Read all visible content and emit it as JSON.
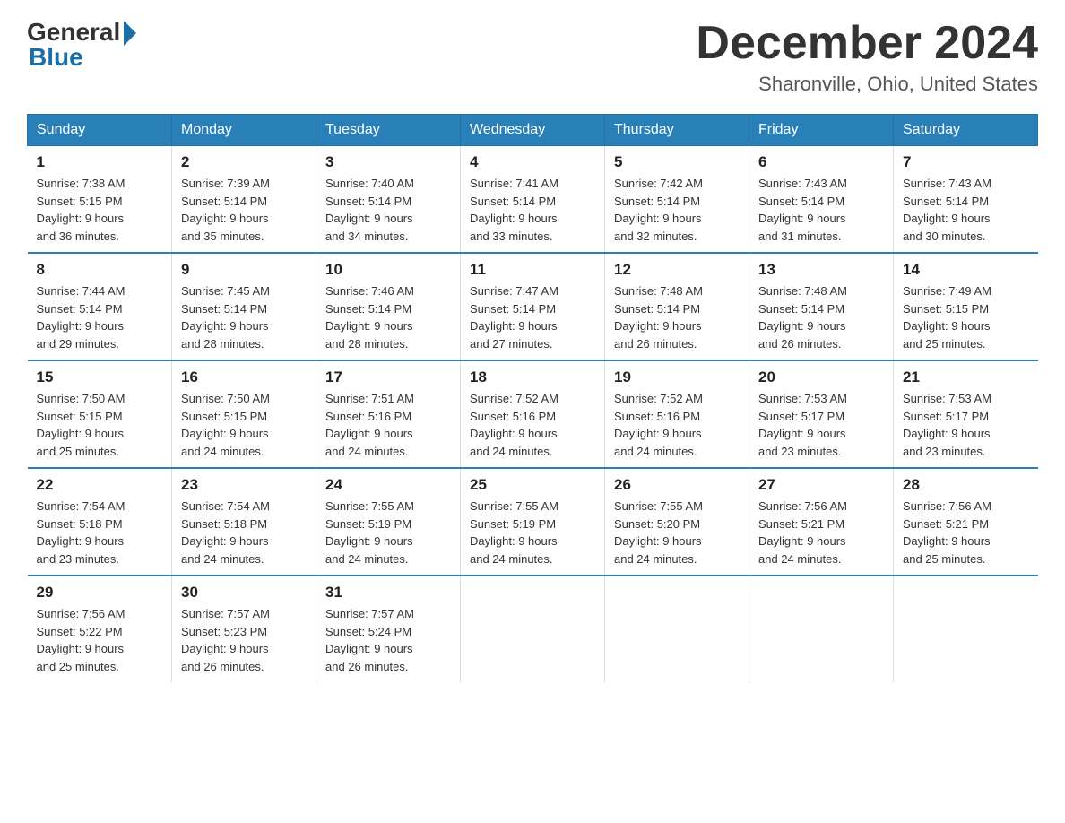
{
  "header": {
    "logo_general": "General",
    "logo_blue": "Blue",
    "month_title": "December 2024",
    "location": "Sharonville, Ohio, United States"
  },
  "days_of_week": [
    "Sunday",
    "Monday",
    "Tuesday",
    "Wednesday",
    "Thursday",
    "Friday",
    "Saturday"
  ],
  "weeks": [
    [
      {
        "day": "1",
        "sunrise": "7:38 AM",
        "sunset": "5:15 PM",
        "daylight": "9 hours and 36 minutes."
      },
      {
        "day": "2",
        "sunrise": "7:39 AM",
        "sunset": "5:14 PM",
        "daylight": "9 hours and 35 minutes."
      },
      {
        "day": "3",
        "sunrise": "7:40 AM",
        "sunset": "5:14 PM",
        "daylight": "9 hours and 34 minutes."
      },
      {
        "day": "4",
        "sunrise": "7:41 AM",
        "sunset": "5:14 PM",
        "daylight": "9 hours and 33 minutes."
      },
      {
        "day": "5",
        "sunrise": "7:42 AM",
        "sunset": "5:14 PM",
        "daylight": "9 hours and 32 minutes."
      },
      {
        "day": "6",
        "sunrise": "7:43 AM",
        "sunset": "5:14 PM",
        "daylight": "9 hours and 31 minutes."
      },
      {
        "day": "7",
        "sunrise": "7:43 AM",
        "sunset": "5:14 PM",
        "daylight": "9 hours and 30 minutes."
      }
    ],
    [
      {
        "day": "8",
        "sunrise": "7:44 AM",
        "sunset": "5:14 PM",
        "daylight": "9 hours and 29 minutes."
      },
      {
        "day": "9",
        "sunrise": "7:45 AM",
        "sunset": "5:14 PM",
        "daylight": "9 hours and 28 minutes."
      },
      {
        "day": "10",
        "sunrise": "7:46 AM",
        "sunset": "5:14 PM",
        "daylight": "9 hours and 28 minutes."
      },
      {
        "day": "11",
        "sunrise": "7:47 AM",
        "sunset": "5:14 PM",
        "daylight": "9 hours and 27 minutes."
      },
      {
        "day": "12",
        "sunrise": "7:48 AM",
        "sunset": "5:14 PM",
        "daylight": "9 hours and 26 minutes."
      },
      {
        "day": "13",
        "sunrise": "7:48 AM",
        "sunset": "5:14 PM",
        "daylight": "9 hours and 26 minutes."
      },
      {
        "day": "14",
        "sunrise": "7:49 AM",
        "sunset": "5:15 PM",
        "daylight": "9 hours and 25 minutes."
      }
    ],
    [
      {
        "day": "15",
        "sunrise": "7:50 AM",
        "sunset": "5:15 PM",
        "daylight": "9 hours and 25 minutes."
      },
      {
        "day": "16",
        "sunrise": "7:50 AM",
        "sunset": "5:15 PM",
        "daylight": "9 hours and 24 minutes."
      },
      {
        "day": "17",
        "sunrise": "7:51 AM",
        "sunset": "5:16 PM",
        "daylight": "9 hours and 24 minutes."
      },
      {
        "day": "18",
        "sunrise": "7:52 AM",
        "sunset": "5:16 PM",
        "daylight": "9 hours and 24 minutes."
      },
      {
        "day": "19",
        "sunrise": "7:52 AM",
        "sunset": "5:16 PM",
        "daylight": "9 hours and 24 minutes."
      },
      {
        "day": "20",
        "sunrise": "7:53 AM",
        "sunset": "5:17 PM",
        "daylight": "9 hours and 23 minutes."
      },
      {
        "day": "21",
        "sunrise": "7:53 AM",
        "sunset": "5:17 PM",
        "daylight": "9 hours and 23 minutes."
      }
    ],
    [
      {
        "day": "22",
        "sunrise": "7:54 AM",
        "sunset": "5:18 PM",
        "daylight": "9 hours and 23 minutes."
      },
      {
        "day": "23",
        "sunrise": "7:54 AM",
        "sunset": "5:18 PM",
        "daylight": "9 hours and 24 minutes."
      },
      {
        "day": "24",
        "sunrise": "7:55 AM",
        "sunset": "5:19 PM",
        "daylight": "9 hours and 24 minutes."
      },
      {
        "day": "25",
        "sunrise": "7:55 AM",
        "sunset": "5:19 PM",
        "daylight": "9 hours and 24 minutes."
      },
      {
        "day": "26",
        "sunrise": "7:55 AM",
        "sunset": "5:20 PM",
        "daylight": "9 hours and 24 minutes."
      },
      {
        "day": "27",
        "sunrise": "7:56 AM",
        "sunset": "5:21 PM",
        "daylight": "9 hours and 24 minutes."
      },
      {
        "day": "28",
        "sunrise": "7:56 AM",
        "sunset": "5:21 PM",
        "daylight": "9 hours and 25 minutes."
      }
    ],
    [
      {
        "day": "29",
        "sunrise": "7:56 AM",
        "sunset": "5:22 PM",
        "daylight": "9 hours and 25 minutes."
      },
      {
        "day": "30",
        "sunrise": "7:57 AM",
        "sunset": "5:23 PM",
        "daylight": "9 hours and 26 minutes."
      },
      {
        "day": "31",
        "sunrise": "7:57 AM",
        "sunset": "5:24 PM",
        "daylight": "9 hours and 26 minutes."
      },
      null,
      null,
      null,
      null
    ]
  ],
  "labels": {
    "sunrise": "Sunrise:",
    "sunset": "Sunset:",
    "daylight": "Daylight:"
  }
}
